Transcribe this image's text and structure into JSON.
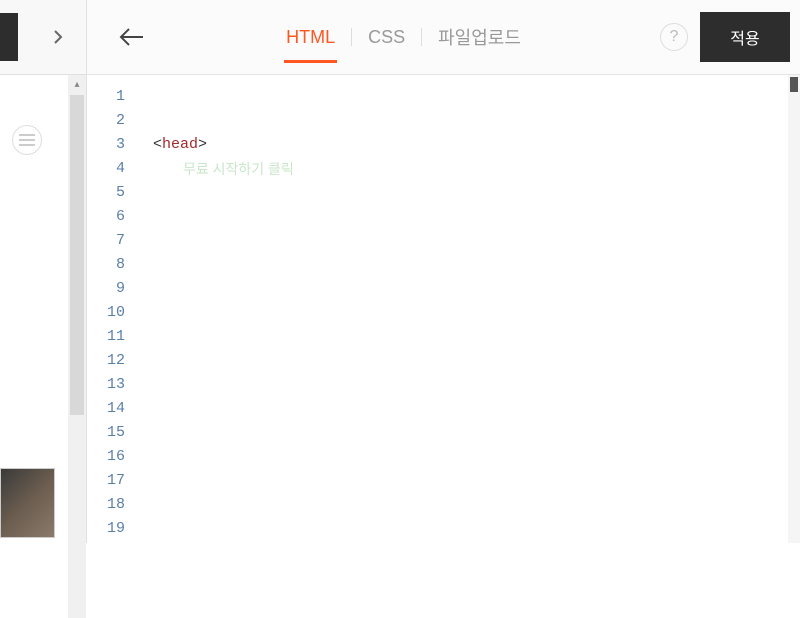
{
  "header": {
    "tabs": {
      "html": "HTML",
      "css": "CSS",
      "upload": "파일업로드"
    },
    "help_label": "?",
    "apply_label": "적용"
  },
  "editor": {
    "line_numbers": [
      "1",
      "2",
      "3",
      "4",
      "5",
      "6",
      "7",
      "8",
      "9",
      "10",
      "11",
      "12",
      "13",
      "14",
      "15",
      "16",
      "17",
      "18",
      "19"
    ],
    "code": {
      "line3": {
        "open": "<",
        "tag": "head",
        "close": ">"
      },
      "line4_hint": "무료 시작하기 클릭"
    }
  },
  "colors": {
    "accent": "#ff5722",
    "dark": "#2d2d2d",
    "line_number": "#5a7fa8",
    "tag": "#a52a2a"
  }
}
